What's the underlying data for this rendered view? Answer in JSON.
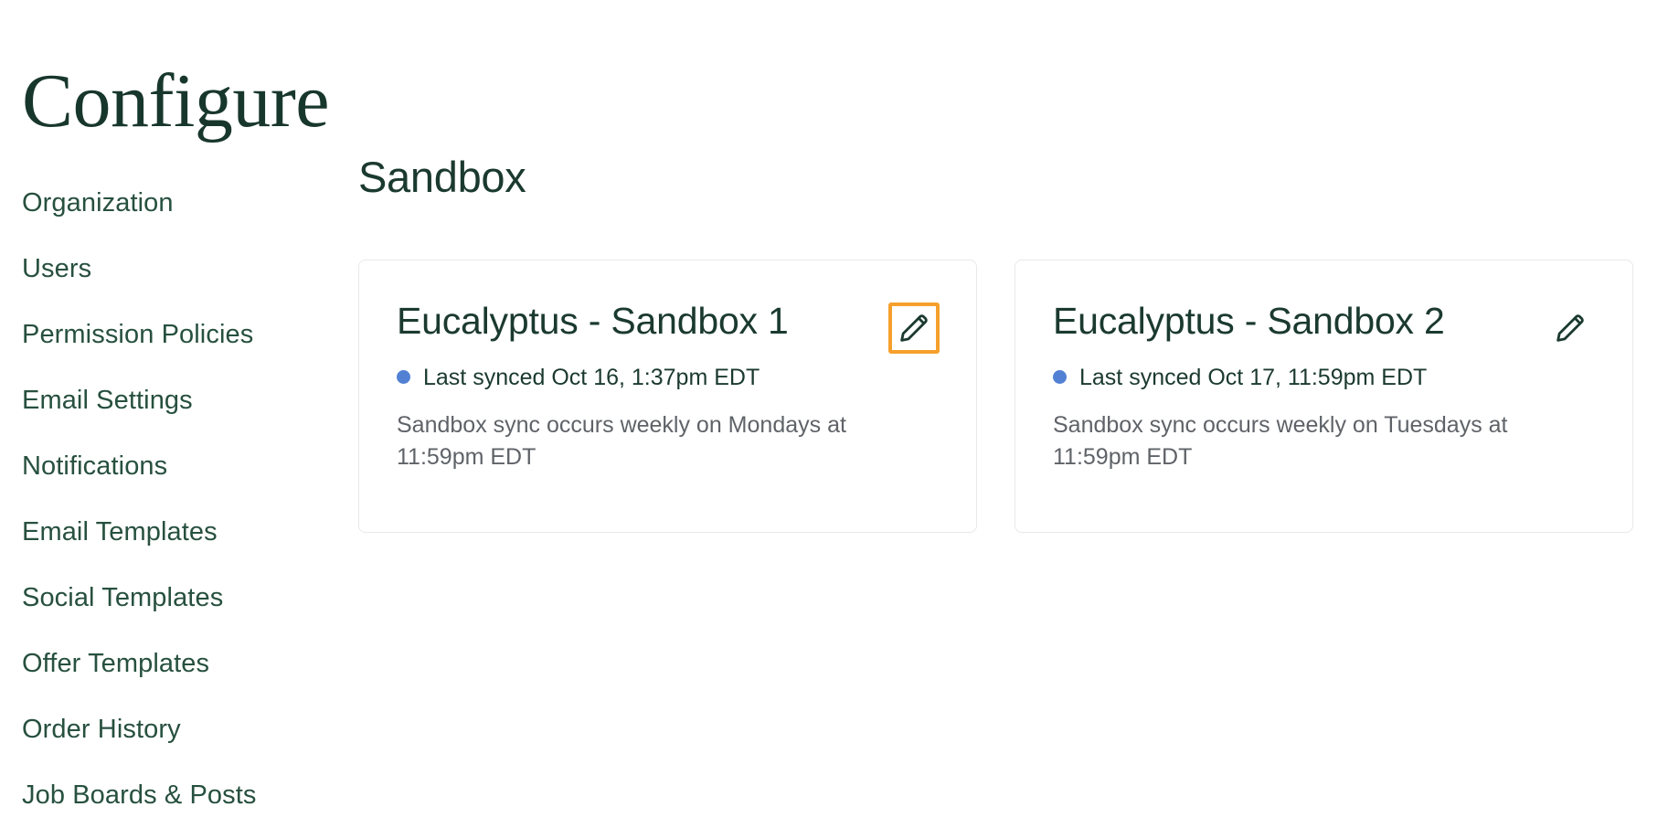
{
  "page": {
    "title": "Configure"
  },
  "sidebar": {
    "items": [
      {
        "label": "Organization",
        "name": "organization"
      },
      {
        "label": "Users",
        "name": "users"
      },
      {
        "label": "Permission Policies",
        "name": "permission-policies"
      },
      {
        "label": "Email Settings",
        "name": "email-settings"
      },
      {
        "label": "Notifications",
        "name": "notifications"
      },
      {
        "label": "Email Templates",
        "name": "email-templates"
      },
      {
        "label": "Social Templates",
        "name": "social-templates"
      },
      {
        "label": "Offer Templates",
        "name": "offer-templates"
      },
      {
        "label": "Order History",
        "name": "order-history"
      },
      {
        "label": "Job Boards & Posts",
        "name": "job-boards-and-posts"
      }
    ]
  },
  "main": {
    "section_title": "Sandbox",
    "cards": [
      {
        "title": "Eucalyptus - Sandbox 1",
        "sync_status": "Last synced Oct 16, 1:37pm EDT",
        "description": "Sandbox sync occurs weekly on Mondays at 11:59pm EDT",
        "edit_icon": "pencil-icon",
        "edit_focused": true
      },
      {
        "title": "Eucalyptus - Sandbox 2",
        "sync_status": "Last synced Oct 17, 11:59pm EDT",
        "description": "Sandbox sync occurs weekly on Tuesdays at 11:59pm EDT",
        "edit_icon": "pencil-icon",
        "edit_focused": false
      }
    ]
  },
  "colors": {
    "brand_green": "#1b3a2f",
    "focus_orange": "#f5a02c",
    "status_blue": "#5281d4",
    "muted_gray": "#5f6368",
    "card_border": "#e8e9ea"
  }
}
